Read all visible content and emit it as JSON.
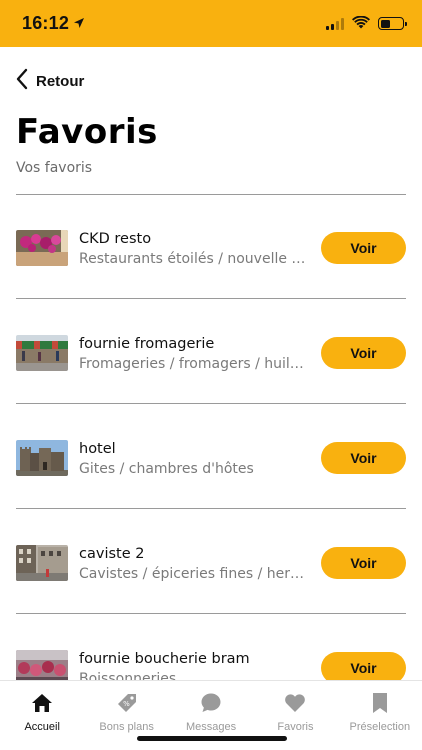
{
  "status_bar": {
    "time": "16:12",
    "background": "#f9b10f",
    "battery_level": 0.45
  },
  "header": {
    "back_label": "Retour",
    "title": "Favoris",
    "subtitle": "Vos favoris"
  },
  "favorites": [
    {
      "title": "CKD resto",
      "category": "Restaurants étoilés / nouvelle cuisine",
      "button": "Voir",
      "thumb": "flowers-photo"
    },
    {
      "title": "fournie fromagerie",
      "category": "Fromageries / fromagers / huileries",
      "button": "Voir",
      "thumb": "market-street-photo"
    },
    {
      "title": "hotel",
      "category": "Gites / chambres d'hôtes",
      "button": "Voir",
      "thumb": "castle-photo"
    },
    {
      "title": "caviste 2",
      "category": "Cavistes / épiceries fines / herboristeries",
      "button": "Voir",
      "thumb": "street-building-photo"
    },
    {
      "title": "fournie boucherie bram",
      "category": "Boissonneries",
      "button": "Voir",
      "thumb": "market-stall-photo"
    }
  ],
  "tabbar": {
    "tabs": [
      {
        "label": "Accueil",
        "icon": "home-icon",
        "active": true
      },
      {
        "label": "Bons plans",
        "icon": "tag-icon",
        "active": false
      },
      {
        "label": "Messages",
        "icon": "chat-bubble-icon",
        "active": false
      },
      {
        "label": "Favoris",
        "icon": "heart-icon",
        "active": false
      },
      {
        "label": "Préselection",
        "icon": "bookmark-icon",
        "active": false
      }
    ]
  },
  "colors": {
    "accent": "#f9b10f",
    "text": "#111111",
    "muted": "#7a7a7a",
    "tab_inactive": "#9a9a9a"
  }
}
